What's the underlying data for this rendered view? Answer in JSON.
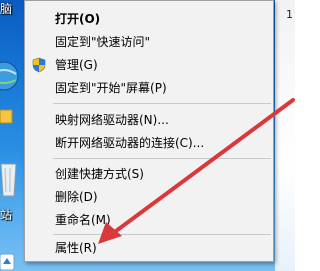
{
  "desktop": {
    "top_label": "脑",
    "mid_label": "站",
    "right_label": "1",
    "arrow_color": "#d9393a"
  },
  "menu": {
    "items": [
      {
        "label": "打开(O)",
        "bold": true
      },
      {
        "label": "固定到\"快速访问\""
      },
      {
        "label": "管理(G)",
        "icon": "shield-icon"
      },
      {
        "label": "固定到\"开始\"屏幕(P)"
      },
      {
        "label": "映射网络驱动器(N)..."
      },
      {
        "label": "断开网络驱动器的连接(C)..."
      },
      {
        "label": "创建快捷方式(S)"
      },
      {
        "label": "删除(D)"
      },
      {
        "label": "重命名(M)"
      },
      {
        "label": "属性(R)"
      }
    ]
  }
}
